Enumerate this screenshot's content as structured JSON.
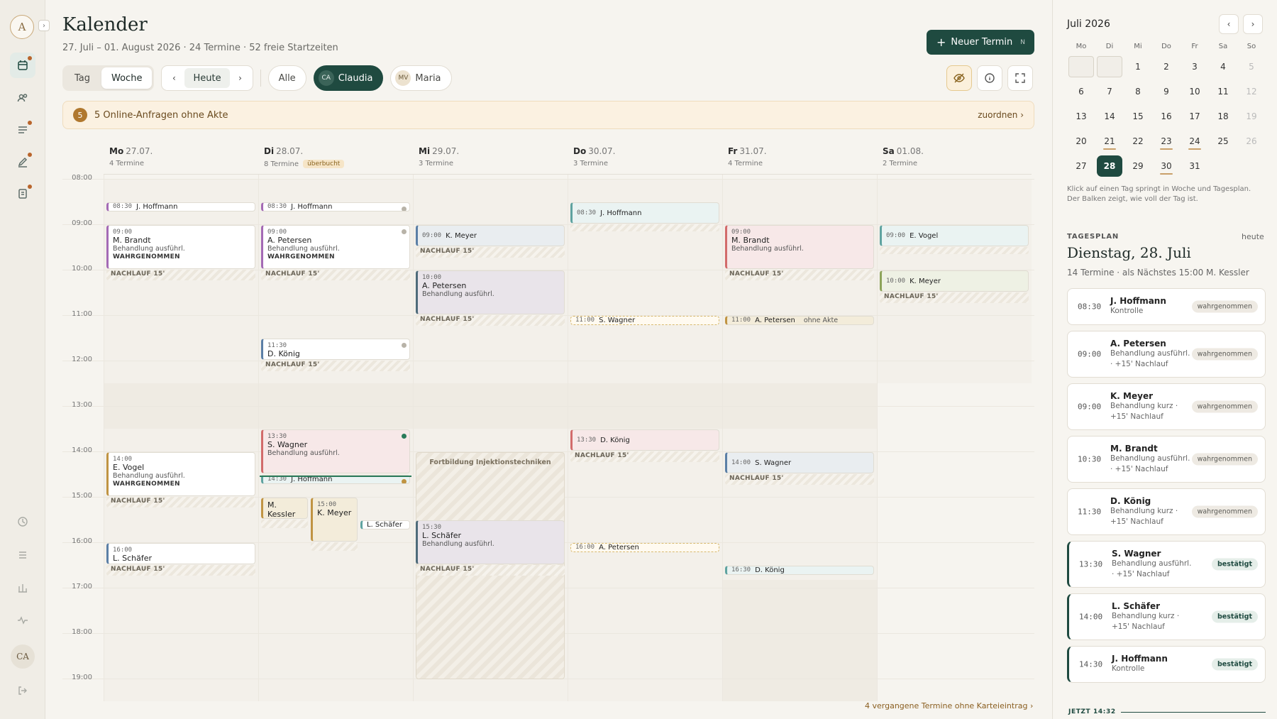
{
  "rail": {
    "logo": "A",
    "avatar": "CA"
  },
  "header": {
    "title": "Kalender",
    "subtitle": "27. Juli – 01. August 2026 · 24 Termine · 52 freie Startzeiten",
    "new_label": "Neuer Termin",
    "new_kbd": "N"
  },
  "toolbar": {
    "tag": "Tag",
    "woche": "Woche",
    "heute": "Heute",
    "alle": "Alle",
    "claudia_initials": "CA",
    "claudia": "Claudia",
    "maria_initials": "MV",
    "maria": "Maria"
  },
  "banner": {
    "count": "5",
    "text": "5 Online-Anfragen ohne Akte",
    "link": "zuordnen ›"
  },
  "days": [
    {
      "dow": "Mo",
      "date": "27.07.",
      "count": "4 Termine",
      "badge": ""
    },
    {
      "dow": "Di",
      "date": "28.07.",
      "count": "8 Termine",
      "badge": "überbucht"
    },
    {
      "dow": "Mi",
      "date": "29.07.",
      "count": "3 Termine",
      "badge": ""
    },
    {
      "dow": "Do",
      "date": "30.07.",
      "count": "3 Termine",
      "badge": ""
    },
    {
      "dow": "Fr",
      "date": "31.07.",
      "count": "4 Termine",
      "badge": ""
    },
    {
      "dow": "Sa",
      "date": "01.08.",
      "count": "2 Termine",
      "badge": ""
    }
  ],
  "hours": [
    "08:00",
    "09:00",
    "10:00",
    "11:00",
    "12:00",
    "13:00",
    "14:00",
    "15:00",
    "16:00",
    "17:00",
    "18:00",
    "19:00"
  ],
  "labels": {
    "nachlauf": "NACHLAUF 15'",
    "wahr": "WAHRGENOMMEN",
    "beh": "Behandlung ausführl.",
    "block": "Fortbildung Injektionstechniken",
    "ohne": "ohne Akte"
  },
  "events": {
    "mo1": {
      "t": "08:30",
      "n": "J. Hoffmann"
    },
    "mo2": {
      "t": "09:00",
      "n": "M. Brandt"
    },
    "mo3": {
      "t": "14:00",
      "n": "E. Vogel"
    },
    "mo4": {
      "t": "16:00",
      "n": "L. Schäfer"
    },
    "di1": {
      "t": "08:30",
      "n": "J. Hoffmann"
    },
    "di2": {
      "t": "09:00",
      "n": "A. Petersen"
    },
    "di3": {
      "t": "11:30",
      "n": "D. König"
    },
    "di4": {
      "t": "13:30",
      "n": "S. Wagner"
    },
    "di5": {
      "t": "14:30",
      "n": "J. Hoffmann"
    },
    "di6": {
      "n": "M. Kessler"
    },
    "di7": {
      "t": "15:00",
      "n": "K. Meyer"
    },
    "di8": {
      "n": "L. Schäfer"
    },
    "mi1": {
      "t": "09:00",
      "n": "K. Meyer"
    },
    "mi2": {
      "t": "10:00",
      "n": "A. Petersen"
    },
    "mi3": {
      "t": "15:30",
      "n": "L. Schäfer"
    },
    "do1": {
      "t": "08:30",
      "n": "J. Hoffmann"
    },
    "do2": {
      "t": "11:00",
      "n": "S. Wagner"
    },
    "do3": {
      "t": "13:30",
      "n": "D. König"
    },
    "do4": {
      "t": "16:00",
      "n": "A. Petersen"
    },
    "fr1": {
      "t": "09:00",
      "n": "M. Brandt"
    },
    "fr2": {
      "t": "11:00",
      "n": "A. Petersen"
    },
    "fr3": {
      "t": "14:00",
      "n": "S. Wagner"
    },
    "fr4": {
      "t": "16:30",
      "n": "D. König"
    },
    "sa1": {
      "t": "09:00",
      "n": "E. Vogel"
    },
    "sa2": {
      "t": "10:00",
      "n": "K. Meyer"
    }
  },
  "footer_link": "4 vergangene Termine ohne Karteieintrag ›",
  "sidebar": {
    "month": "Juli 2026",
    "prev": "‹",
    "next": "›",
    "weekdays": [
      "Mo",
      "Di",
      "Mi",
      "Do",
      "Fr",
      "Sa",
      "So"
    ],
    "hint": "Klick auf einen Tag springt in Woche und Tagesplan. Der Balken zeigt, wie voll der Tag ist.",
    "tagesplan": "TAGESPLAN",
    "heute": "heute",
    "date": "Dienstag, 28. Juli",
    "summary": "14 Termine · als Nächstes 15:00 M. Kessler",
    "now": "JETZT 14:32",
    "appointments": [
      {
        "time": "08:30",
        "name": "J. Hoffmann",
        "desc": "Kontrolle",
        "status": "wahrgenommen",
        "conf": false
      },
      {
        "time": "09:00",
        "name": "A. Petersen",
        "desc": "Behandlung ausführl. · +15' Nachlauf",
        "status": "wahrgenommen",
        "conf": false
      },
      {
        "time": "09:00",
        "name": "K. Meyer",
        "desc": "Behandlung kurz · +15' Nachlauf",
        "status": "wahrgenommen",
        "conf": false
      },
      {
        "time": "10:30",
        "name": "M. Brandt",
        "desc": "Behandlung ausführl. · +15' Nachlauf",
        "status": "wahrgenommen",
        "conf": false
      },
      {
        "time": "11:30",
        "name": "D. König",
        "desc": "Behandlung kurz · +15' Nachlauf",
        "status": "wahrgenommen",
        "conf": false
      },
      {
        "time": "13:30",
        "name": "S. Wagner",
        "desc": "Behandlung ausführl. · +15' Nachlauf",
        "status": "bestätigt",
        "conf": true
      },
      {
        "time": "14:00",
        "name": "L. Schäfer",
        "desc": "Behandlung kurz · +15' Nachlauf",
        "status": "bestätigt",
        "conf": true
      },
      {
        "time": "14:30",
        "name": "J. Hoffmann",
        "desc": "Kontrolle",
        "status": "bestätigt",
        "conf": true
      }
    ]
  }
}
